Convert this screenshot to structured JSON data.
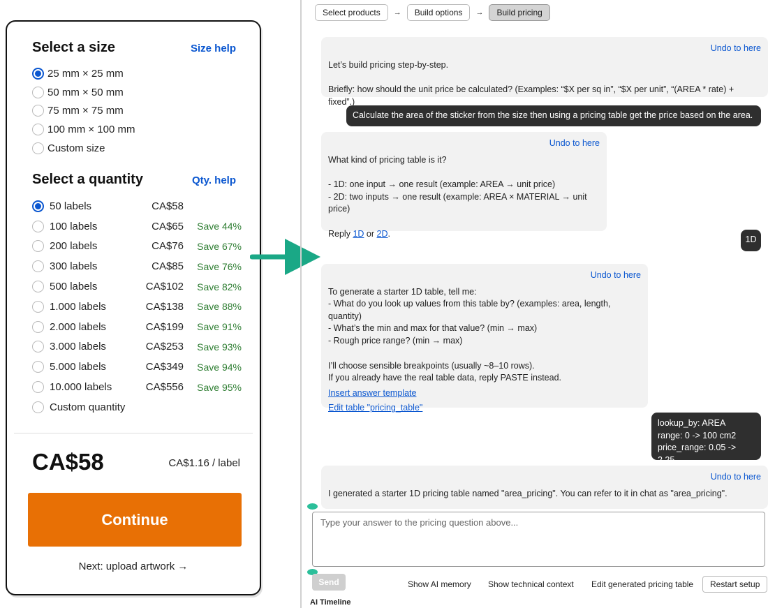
{
  "product": {
    "size_title": "Select a size",
    "size_help": "Size help",
    "sizes": [
      "25 mm × 25 mm",
      "50 mm × 50 mm",
      "75 mm × 75 mm",
      "100 mm × 100 mm",
      "Custom size"
    ],
    "selected_size": 0,
    "qty_title": "Select a quantity",
    "qty_help": "Qty. help",
    "quantities": [
      {
        "label": "50 labels",
        "price": "CA$58",
        "save": ""
      },
      {
        "label": "100 labels",
        "price": "CA$65",
        "save": "Save 44%"
      },
      {
        "label": "200 labels",
        "price": "CA$76",
        "save": "Save 67%"
      },
      {
        "label": "300 labels",
        "price": "CA$85",
        "save": "Save 76%"
      },
      {
        "label": "500 labels",
        "price": "CA$102",
        "save": "Save 82%"
      },
      {
        "label": "1.000 labels",
        "price": "CA$138",
        "save": "Save 88%"
      },
      {
        "label": "2.000 labels",
        "price": "CA$199",
        "save": "Save 91%"
      },
      {
        "label": "3.000 labels",
        "price": "CA$253",
        "save": "Save 93%"
      },
      {
        "label": "5.000 labels",
        "price": "CA$349",
        "save": "Save 94%"
      },
      {
        "label": "10.000 labels",
        "price": "CA$556",
        "save": "Save 95%"
      },
      {
        "label": "Custom quantity",
        "price": "",
        "save": ""
      }
    ],
    "selected_qty": 0,
    "total": "CA$58",
    "per_label": "CA$1.16 / label",
    "continue_label": "Continue",
    "next_text": "Next: upload artwork →"
  },
  "breadcrumbs": {
    "step1": "Select products",
    "step2": "Build options",
    "step3": "Build pricing",
    "separator": "→"
  },
  "chat": {
    "undo_label": "Undo to here",
    "m1_line1": "Let’s build pricing step-by-step.",
    "m1_line2": "Briefly: how should the unit price be calculated? (Examples: “$X per sq in”, “$X per unit”,  “(AREA * rate) + fixed”.)",
    "u1": "Calculate the area of the sticker from the size then using a pricing table get the price based on the area.",
    "m2_q": "What kind of pricing table is it?",
    "m2_opt1": "- 1D: one input → one result (example: AREA → unit price)",
    "m2_opt2": "- 2D: two inputs → one result (example: AREA × MATERIAL → unit price)",
    "m2_reply": "Reply",
    "m2_link1": "1D",
    "m2_or": "or",
    "m2_link2": "2D",
    "m2_period": ".",
    "u2": "1D",
    "m3_l1": "To generate a starter 1D table, tell me:",
    "m3_l2": "- What do you look up values from this table by? (examples: area, length, quantity)",
    "m3_l3": "- What’s the min and max for that value? (min → max)",
    "m3_l4": "- Rough price range? (min → max)",
    "m3_l5": "I’ll choose sensible breakpoints (usually ~8–10 rows).",
    "m3_l6": "If you already have the real table data, reply PASTE instead.",
    "m3_link1": "Insert answer template",
    "m3_link2": "Edit table \"pricing_table\"",
    "u3_l1": "lookup_by: AREA",
    "u3_l2": "range: 0 -> 100 cm2",
    "u3_l3": "price_range: 0.05 -> 2.25",
    "m4": "I generated a starter 1D pricing table named \"area_pricing\". You can refer to it in chat as \"area_pricing\"."
  },
  "composer": {
    "placeholder": "Type your answer to the pricing question above...",
    "send_label": "Send"
  },
  "footer": {
    "show_memory": "Show AI memory",
    "show_context": "Show technical context",
    "edit_table": "Edit generated pricing table",
    "restart": "Restart setup",
    "timeline": "AI Timeline"
  },
  "colors": {
    "accent": "#0b57d0",
    "continue": "#e87005",
    "save_green": "#2e7d32",
    "arrow": "#1aa886"
  }
}
